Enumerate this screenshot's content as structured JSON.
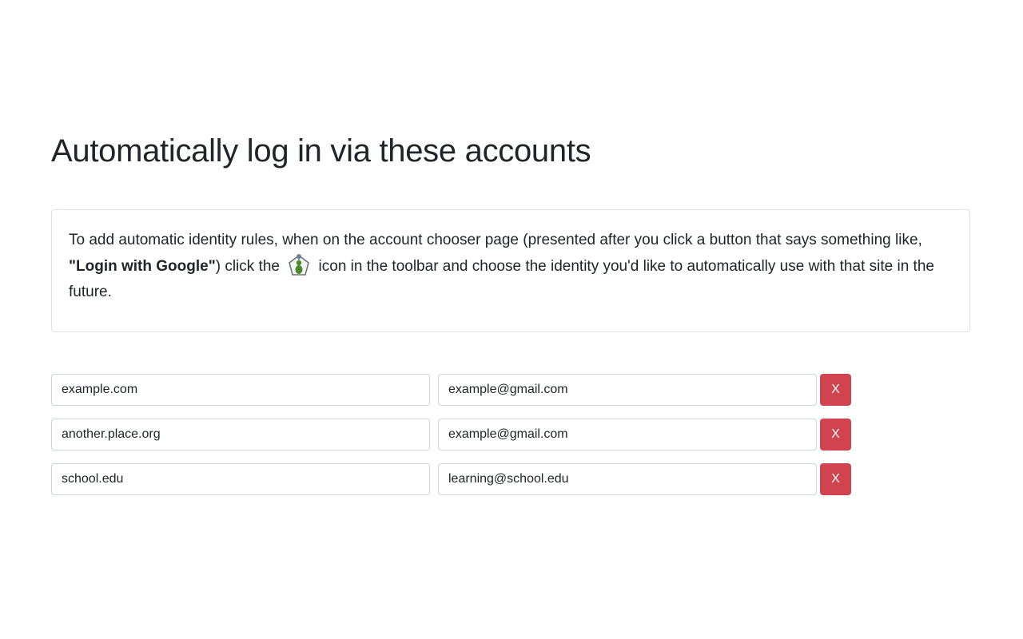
{
  "header": {
    "title": "Automatically log in via these accounts"
  },
  "info": {
    "part1": "To add automatic identity rules, when on the account chooser page (presented after you click a button that says something like, ",
    "bold": "\"Login with Google\"",
    "part2": ") click the",
    "icon": "extension-identity-icon",
    "part3": "icon in the toolbar and choose the identity you'd like to automatically use with that site in the future."
  },
  "rules": [
    {
      "site": "example.com",
      "account": "example@gmail.com",
      "remove_label": "X"
    },
    {
      "site": "another.place.org",
      "account": "example@gmail.com",
      "remove_label": "X"
    },
    {
      "site": "school.edu",
      "account": "learning@school.edu",
      "remove_label": "X"
    }
  ],
  "colors": {
    "remove_button": "#d1434f",
    "border": "#dee2e6",
    "text": "#212529"
  }
}
